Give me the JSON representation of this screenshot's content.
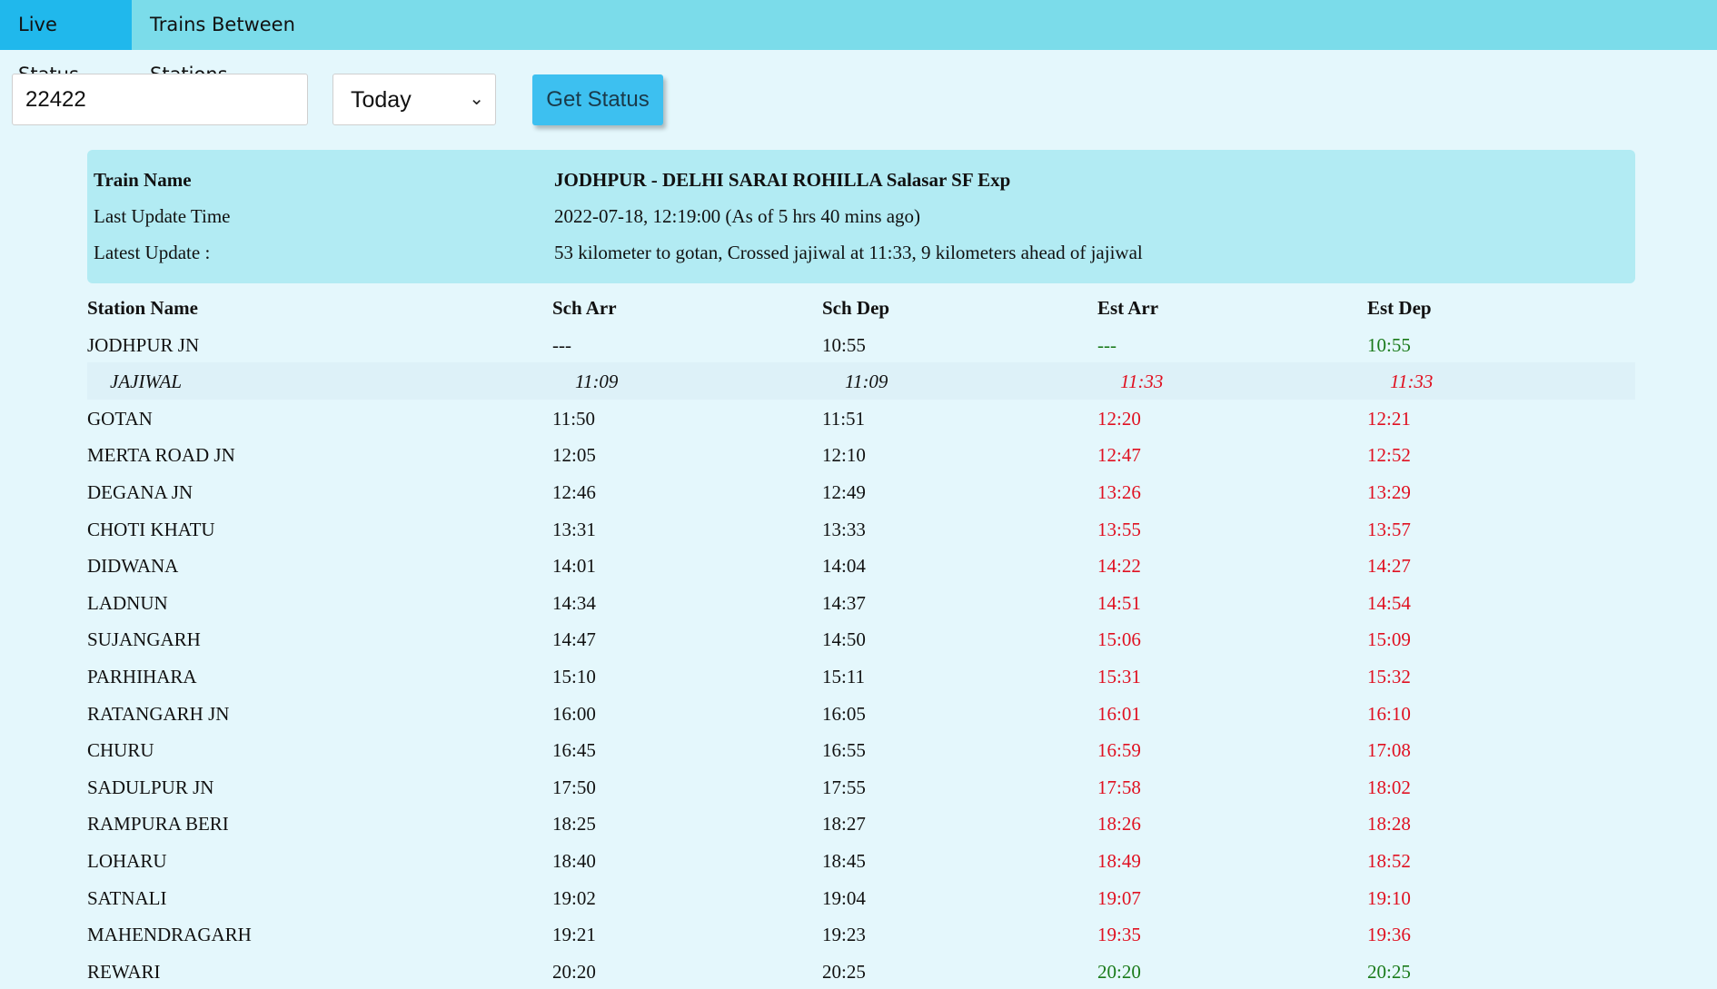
{
  "nav": {
    "tabs": [
      {
        "label": "Live Status",
        "active": true
      },
      {
        "label": "Trains Between Stations",
        "active": false
      }
    ]
  },
  "search": {
    "train_number": "22422",
    "day_selected": "Today",
    "button_label": "Get Status"
  },
  "info": {
    "train_name_label": "Train Name",
    "train_name": "JODHPUR - DELHI SARAI ROHILLA Salasar SF Exp",
    "last_update_label": "Last Update Time",
    "last_update": "2022-07-18, 12:19:00 (As of 5 hrs 40 mins ago)",
    "latest_update_label": "Latest Update :",
    "latest_update": "53 kilometer to gotan, Crossed jajiwal at 11:33, 9 kilometers ahead of jajiwal"
  },
  "colors": {
    "late": "#e01020",
    "on_time": "#1a7a1a",
    "accent": "#20b8ec"
  },
  "table": {
    "headers": [
      "Station Name",
      "Sch Arr",
      "Sch Dep",
      "Est Arr",
      "Est Dep"
    ],
    "rows": [
      {
        "station": "JODHPUR JN",
        "sch_arr": "---",
        "sch_dep": "10:55",
        "est_arr": "---",
        "est_dep": "10:55",
        "status": "ontime"
      },
      {
        "station": "JAJIWAL",
        "sch_arr": "11:09",
        "sch_dep": "11:09",
        "est_arr": "11:33",
        "est_dep": "11:33",
        "status": "late",
        "via": true
      },
      {
        "station": "GOTAN",
        "sch_arr": "11:50",
        "sch_dep": "11:51",
        "est_arr": "12:20",
        "est_dep": "12:21",
        "status": "late"
      },
      {
        "station": "MERTA ROAD JN",
        "sch_arr": "12:05",
        "sch_dep": "12:10",
        "est_arr": "12:47",
        "est_dep": "12:52",
        "status": "late"
      },
      {
        "station": "DEGANA JN",
        "sch_arr": "12:46",
        "sch_dep": "12:49",
        "est_arr": "13:26",
        "est_dep": "13:29",
        "status": "late"
      },
      {
        "station": "CHOTI KHATU",
        "sch_arr": "13:31",
        "sch_dep": "13:33",
        "est_arr": "13:55",
        "est_dep": "13:57",
        "status": "late"
      },
      {
        "station": "DIDWANA",
        "sch_arr": "14:01",
        "sch_dep": "14:04",
        "est_arr": "14:22",
        "est_dep": "14:27",
        "status": "late"
      },
      {
        "station": "LADNUN",
        "sch_arr": "14:34",
        "sch_dep": "14:37",
        "est_arr": "14:51",
        "est_dep": "14:54",
        "status": "late"
      },
      {
        "station": "SUJANGARH",
        "sch_arr": "14:47",
        "sch_dep": "14:50",
        "est_arr": "15:06",
        "est_dep": "15:09",
        "status": "late"
      },
      {
        "station": "PARHIHARA",
        "sch_arr": "15:10",
        "sch_dep": "15:11",
        "est_arr": "15:31",
        "est_dep": "15:32",
        "status": "late"
      },
      {
        "station": "RATANGARH JN",
        "sch_arr": "16:00",
        "sch_dep": "16:05",
        "est_arr": "16:01",
        "est_dep": "16:10",
        "status": "late"
      },
      {
        "station": "CHURU",
        "sch_arr": "16:45",
        "sch_dep": "16:55",
        "est_arr": "16:59",
        "est_dep": "17:08",
        "status": "late"
      },
      {
        "station": "SADULPUR JN",
        "sch_arr": "17:50",
        "sch_dep": "17:55",
        "est_arr": "17:58",
        "est_dep": "18:02",
        "status": "late"
      },
      {
        "station": "RAMPURA BERI",
        "sch_arr": "18:25",
        "sch_dep": "18:27",
        "est_arr": "18:26",
        "est_dep": "18:28",
        "status": "late"
      },
      {
        "station": "LOHARU",
        "sch_arr": "18:40",
        "sch_dep": "18:45",
        "est_arr": "18:49",
        "est_dep": "18:52",
        "status": "late"
      },
      {
        "station": "SATNALI",
        "sch_arr": "19:02",
        "sch_dep": "19:04",
        "est_arr": "19:07",
        "est_dep": "19:10",
        "status": "late"
      },
      {
        "station": "MAHENDRAGARH",
        "sch_arr": "19:21",
        "sch_dep": "19:23",
        "est_arr": "19:35",
        "est_dep": "19:36",
        "status": "late"
      },
      {
        "station": "REWARI",
        "sch_arr": "20:20",
        "sch_dep": "20:25",
        "est_arr": "20:20",
        "est_dep": "20:25",
        "status": "ontime"
      }
    ]
  }
}
